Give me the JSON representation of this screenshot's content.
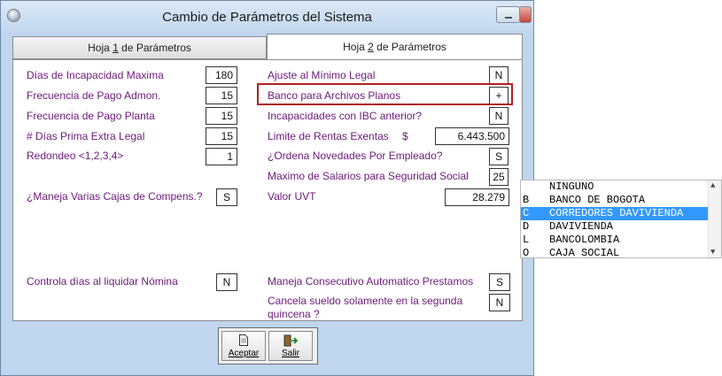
{
  "window": {
    "title": "Cambio de Parámetros del Sistema"
  },
  "tabs": [
    {
      "pre": "Hoja ",
      "key": "1",
      "post": " de Parámetros"
    },
    {
      "pre": "Hoja ",
      "key": "2",
      "post": " de Parámetros"
    }
  ],
  "left": {
    "dias_incapacidad": {
      "label": "Días de Incapacidad Maxima",
      "value": "180"
    },
    "frecuencia_admon": {
      "label": "Frecuencia de Pago Admon.",
      "value": "15"
    },
    "frecuencia_planta": {
      "label": "Frecuencia de Pago Planta",
      "value": "15"
    },
    "dias_prima": {
      "label": "# Días Prima Extra Legal",
      "value": "15"
    },
    "redondeo": {
      "label": "Redondeo <1,2,3,4>",
      "value": "1"
    },
    "cajas_compens": {
      "label": "¿Maneja Varias Cajas de Compens.?",
      "value": "S"
    },
    "controla_dias": {
      "label": "Controla días al liquidar Nómina",
      "value": "N"
    }
  },
  "right": {
    "ajuste_minimo": {
      "label": "Ajuste al Mínimo Legal",
      "value": "N"
    },
    "banco_archivos": {
      "label": "Banco para Archivos Planos",
      "value": "+"
    },
    "incapacidades_ibc": {
      "label": "Incapacidades con IBC anterior?",
      "value": "N"
    },
    "limite_rentas": {
      "label": "Limite de Rentas Exentas",
      "currency": "$",
      "value": "6.443.500"
    },
    "ordena_novedades": {
      "label": "¿Ordena Novedades Por Empleado?",
      "value": "S"
    },
    "maximo_salarios": {
      "label": "Maximo de Salarios para Seguridad Social",
      "value": "25"
    },
    "valor_uvt": {
      "label": "Valor UVT",
      "value": "28.279"
    },
    "consecutivo_prestamos": {
      "label": "Maneja Consecutivo Automatico Prestamos",
      "value": "S"
    },
    "cancela_sueldo": {
      "label_line1": "Cancela sueldo solamente en la segunda",
      "label_line2": "quincena ?",
      "value": "N"
    }
  },
  "buttons": {
    "aceptar": {
      "label": "Aceptar",
      "icon": "document-icon"
    },
    "salir": {
      "label": "Salir",
      "icon": "exit-door-icon"
    }
  },
  "dropdown": {
    "options": [
      {
        "code": "",
        "name": "NINGUNO"
      },
      {
        "code": "B",
        "name": "BANCO DE BOGOTA"
      },
      {
        "code": "C",
        "name": "CORREDORES DAVIVIENDA"
      },
      {
        "code": "D",
        "name": "DAVIVIENDA"
      },
      {
        "code": "L",
        "name": "BANCOLOMBIA"
      },
      {
        "code": "O",
        "name": "CAJA SOCIAL"
      }
    ],
    "selected_index": 2,
    "selection_color": "#3399ff"
  },
  "colors": {
    "label": "#6d1a7a",
    "highlight_border": "#b02020",
    "window_bg": "#bfd6ee"
  }
}
